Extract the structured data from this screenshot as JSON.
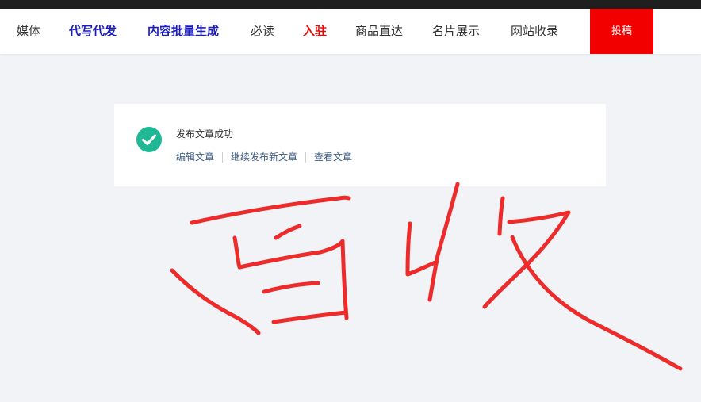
{
  "nav": {
    "items": [
      {
        "label": "媒体"
      },
      {
        "label": "代写代发"
      },
      {
        "label": "内容批量生成"
      },
      {
        "label": "必读"
      },
      {
        "label": "入驻"
      },
      {
        "label": "商品直达"
      },
      {
        "label": "名片展示"
      },
      {
        "label": "网站收录"
      }
    ],
    "submit_label": "投稿"
  },
  "result": {
    "title": "发布文章成功",
    "links": [
      "编辑文章",
      "继续发布新文章",
      "查看文章"
    ]
  },
  "icons": {
    "success": "check-circle-icon"
  },
  "colors": {
    "success_green": "#1fb894",
    "submit_red": "#f20000",
    "link": "#3d5a80",
    "scribble": "#ee2b2b"
  }
}
